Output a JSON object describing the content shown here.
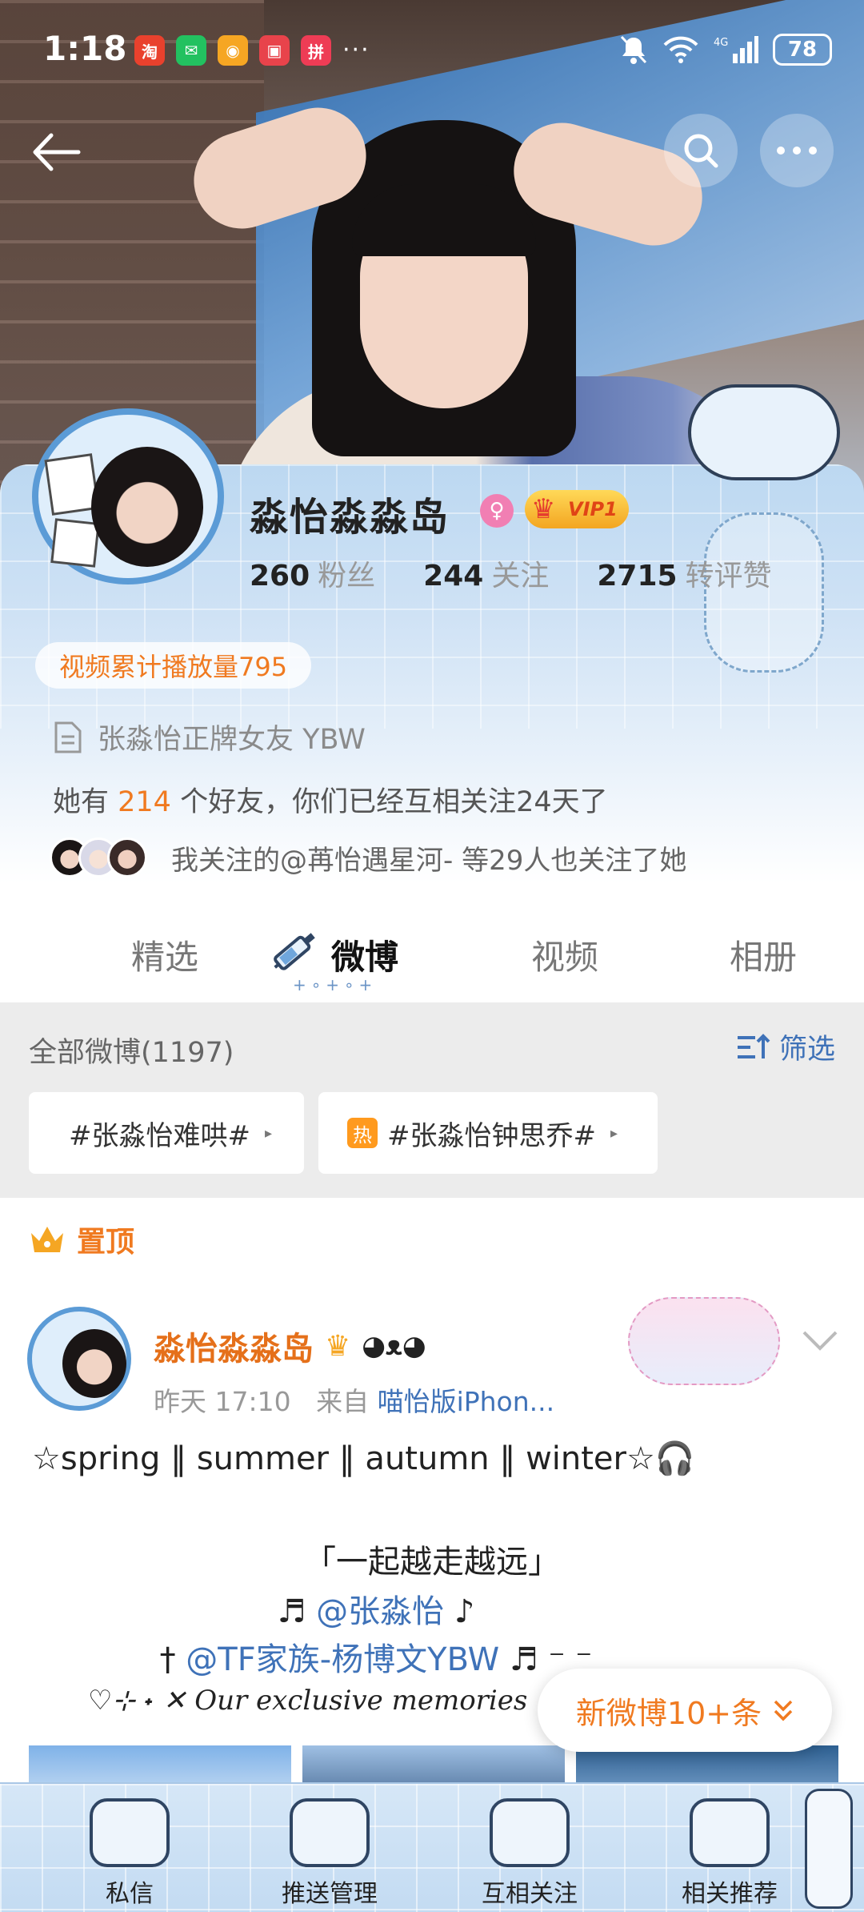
{
  "status_bar": {
    "time": "1:18",
    "more_apps": "···",
    "battery": "78",
    "network": "4G"
  },
  "profile": {
    "name": "淼怡淼淼岛",
    "vip_label": "VIP1",
    "gender_symbol": "♀",
    "stats": [
      {
        "num": "260",
        "label": "粉丝"
      },
      {
        "num": "244",
        "label": "关注"
      },
      {
        "num": "2715",
        "label": "转评赞"
      }
    ],
    "play_count": "视频累计播放量795",
    "bio": "张淼怡正牌女友 YBW",
    "friends_prefix": "她有 ",
    "friends_count": "214",
    "friends_suffix": " 个好友，你们已经互相关注24天了",
    "mutual_text": "我关注的@苒怡遇星河- 等29人也关注了她"
  },
  "tabs": [
    {
      "label": "精选",
      "active": false
    },
    {
      "label": "微博",
      "active": true
    },
    {
      "label": "视频",
      "active": false
    },
    {
      "label": "相册",
      "active": false
    }
  ],
  "tab_deco": "+∘+∘+",
  "filter": {
    "all_label": "全部微博(1197)",
    "filter_label": "筛选",
    "chips": [
      {
        "text": "#张淼怡难哄#",
        "hot": false
      },
      {
        "text": "#张淼怡钟思乔#",
        "hot": true,
        "badge": "热"
      }
    ]
  },
  "post": {
    "pinned_label": "置顶",
    "author": "淼怡淼淼岛",
    "time": "昨天 17:10",
    "from_label": "来自",
    "source": "喵怡版iPhon...",
    "lines": {
      "l1": "☆spring ‖ summer ‖ autumn ‖ winter☆🎧",
      "l2": "「一起越走越远」",
      "l3_prefix": "♬ ",
      "l3_link": "@张淼怡",
      "l3_suffix": " ♪",
      "l4_prefix": "† ",
      "l4_link": "@TF家族-杨博文YBW",
      "l4_suffix": " ♬ ⁻ ⁻",
      "l5": "♡⊹ ˖ ✕ Our exclusive memories"
    }
  },
  "new_posts_label": "新微博10+条",
  "bottom_bar": [
    {
      "label": "私信"
    },
    {
      "label": "推送管理"
    },
    {
      "label": "互相关注"
    },
    {
      "label": "相关推荐"
    }
  ],
  "colors": {
    "accent_orange": "#f07a20",
    "link_blue": "#3f72b8",
    "vip_gold": "#f3a521"
  }
}
